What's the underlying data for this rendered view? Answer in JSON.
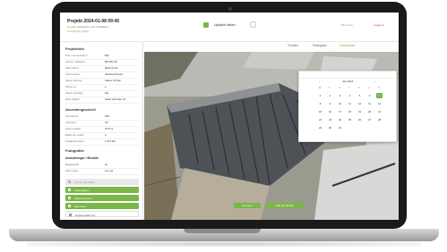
{
  "header": {
    "project_title": "Projekt 2024-01-08 09:45",
    "project_subtitle": "Vy över fastigheten och installation",
    "project_status": "Granskning pågår",
    "date_label": "Upptäck datum",
    "user_label": "Min konto",
    "logout_label": "Logga ut"
  },
  "tabs": [
    {
      "label": "Översikt"
    },
    {
      "label": "Ritningsdel"
    },
    {
      "label": "Drönarbilder"
    }
  ],
  "sidebar": {
    "section_project": "Projektinfo",
    "project_rows": [
      {
        "key": "Proj. nummer/namn",
        "value": "Bbs"
      },
      {
        "key": "Adress / fastighet",
        "value": "Bbf 001-60"
      },
      {
        "key": "Skick datum",
        "value": "2024-01-05"
      },
      {
        "key": "Stock ansvar",
        "value": "Sandra Zenkvist"
      },
      {
        "key": "Status sökning",
        "value": "Status 1/5 klar"
      },
      {
        "key": "Takyta m²",
        "value": "2"
      },
      {
        "key": "Status koppling",
        "value": "Nej"
      },
      {
        "key": "Skick åtgärd",
        "value": "Skick 1/4/9 klar 1/1"
      }
    ],
    "section_install": "Anordning/solcell",
    "install_rows": [
      {
        "key": "Takmaterial",
        "value": "Plåt"
      },
      {
        "key": "Takvinkel",
        "value": "10°"
      },
      {
        "key": "Antal moduler",
        "value": "1675 st"
      },
      {
        "key": "Effekt per modul",
        "value": "2"
      },
      {
        "key": "Installerad effekt",
        "value": "1 567 kW"
      }
    ],
    "section_extra": "Fotografier",
    "section_notes": "Anteckningar / Bemärk",
    "note_rows": [
      {
        "key": "Byggnadsår",
        "value": "ok"
      },
      {
        "key": "Taket gräns",
        "value": "Lös yta"
      }
    ],
    "buttons": [
      {
        "label": "Ladda upp bilder",
        "style": "disabled"
      },
      {
        "label": "Visa rapport",
        "style": "green"
      },
      {
        "label": "Skicka till kund",
        "style": "green"
      },
      {
        "label": "Exportera",
        "style": "green"
      },
      {
        "label": "Hantera åtkomst",
        "style": "outline"
      }
    ]
  },
  "datepicker": {
    "month_label": "Jan 2024",
    "prev": "‹",
    "next": "›",
    "weekdays": [
      "M",
      "T",
      "O",
      "T",
      "F",
      "L",
      "S"
    ],
    "days": [
      "1",
      "2",
      "3",
      "4",
      "5",
      "6",
      "7",
      "8",
      "9",
      "10",
      "11",
      "12",
      "13",
      "14",
      "15",
      "16",
      "17",
      "18",
      "19",
      "20",
      "21",
      "22",
      "23",
      "24",
      "25",
      "26",
      "27",
      "28",
      "29",
      "30",
      "31"
    ],
    "selected_day": "7"
  },
  "map_buttons": [
    {
      "label": "Zooma in"
    },
    {
      "label": "Mät yta på bild"
    }
  ],
  "colors": {
    "accent": "#7ab648",
    "bezel": "#1a1a1a",
    "danger": "#c0392b"
  }
}
